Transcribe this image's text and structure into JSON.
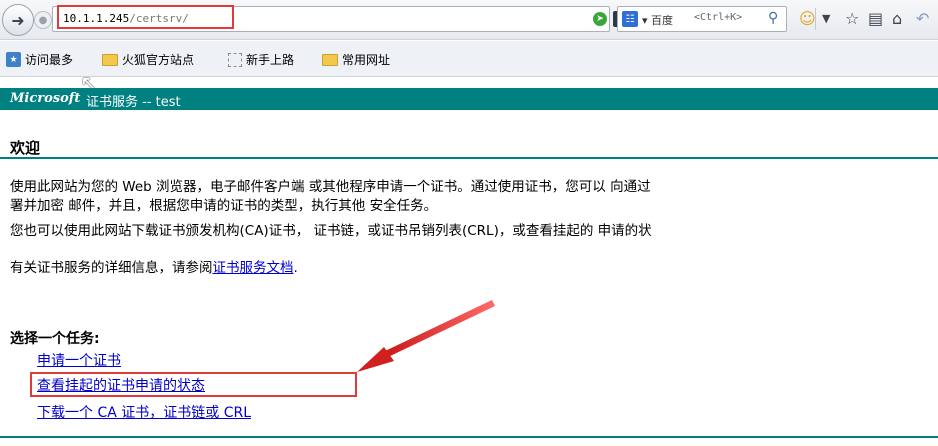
{
  "browser": {
    "url_host": "10.1.1.245",
    "url_path": "/certsrv/",
    "search_engine": "百度",
    "search_placeholder": "<Ctrl+K>",
    "bookmarks": [
      "访问最多",
      "火狐官方站点",
      "新手上路",
      "常用网址"
    ]
  },
  "header": {
    "logo": "Microsoft",
    "title": "证书服务  --  test"
  },
  "page": {
    "welcome": "欢迎",
    "para1_line1": "使用此网站为您的 Web 浏览器，电子邮件客户端 或其他程序申请一个证书。通过使用证书，您可以 向通过",
    "para1_line2": "署并加密 邮件，并且，根据您申请的证书的类型，执行其他 安全任务。",
    "para2": "您也可以使用此网站下载证书颁发机构(CA)证书，  证书链，或证书吊销列表(CRL)，或查看挂起的 申请的状",
    "para3_prefix": "有关证书服务的详细信息，请参阅",
    "para3_link": "证书服务文档",
    "para3_suffix": ".",
    "task_title": "选择一个任务:",
    "tasks": [
      "申请一个证书",
      "查看挂起的证书申请的状态",
      "下载一个 CA 证书，证书链或 CRL"
    ]
  },
  "colors": {
    "header_bg": "#008080",
    "link": "#0000cc",
    "highlight": "#e03b3b"
  }
}
